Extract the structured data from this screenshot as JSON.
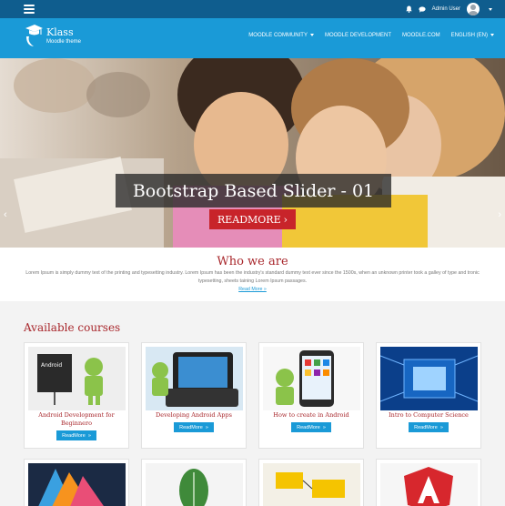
{
  "topbar": {
    "user_name": "Admin User"
  },
  "header": {
    "logo_name": "Klass",
    "logo_subtitle": "Moodle theme",
    "nav": [
      "MOODLE COMMUNITY",
      "MOODLE DEVELOPMENT",
      "MOODLE.COM",
      "ENGLISH (EN)"
    ]
  },
  "slider": {
    "caption": "Bootstrap Based Slider - 01",
    "button_label": "READMORE",
    "arrow_prev": "‹",
    "arrow_next": "›"
  },
  "who": {
    "title": "Who we are",
    "text": "Lorem Ipsum is simply dummy text of the printing and typesetting industry. Lorem Ipsum has been the industry's standard dummy text ever since the 1500s, when an unknown printer took a galley of type and tronic typesetting, sheets taining Lorem Ipsum passages.",
    "link": "Read More »"
  },
  "courses": {
    "title": "Available courses",
    "items": [
      {
        "title": "Android Development for Beginnero",
        "button": "ReadMore"
      },
      {
        "title": "Developing Android Apps",
        "button": "ReadMore"
      },
      {
        "title": "How to create in Android",
        "button": "ReadMore"
      },
      {
        "title": "Intro to Computer Science",
        "button": "ReadMore"
      }
    ]
  },
  "colors": {
    "primary": "#1a9ad7",
    "topbar": "#0f5d8e",
    "accent_red": "#a8262b",
    "button_red": "#c8242a"
  }
}
